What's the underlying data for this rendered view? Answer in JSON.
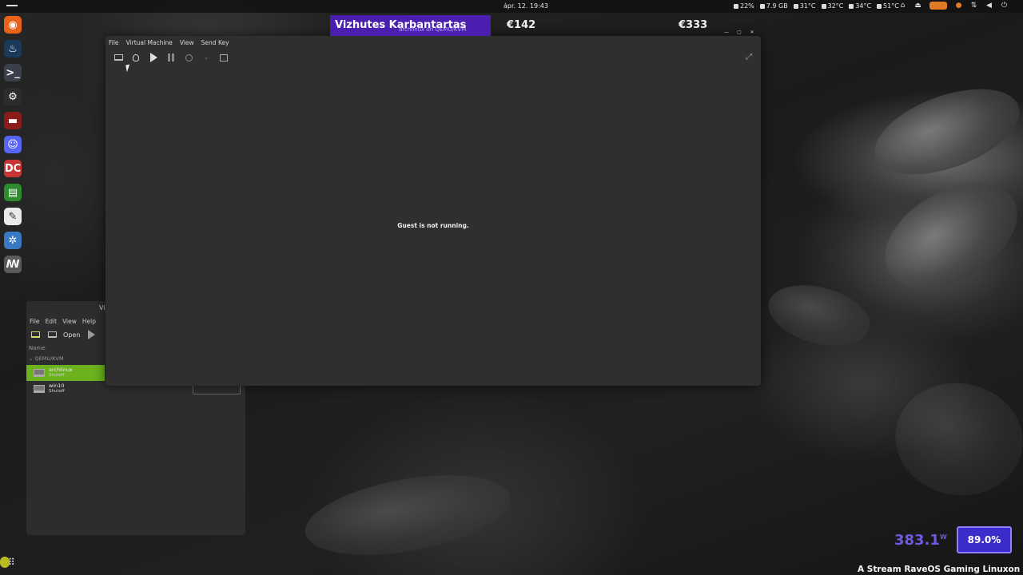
{
  "topbar": {
    "clock": "ápr. 12.  19:43",
    "stats": [
      "22%",
      "7.9 GB",
      "31°C",
      "32°C",
      "34°C",
      "51°C"
    ]
  },
  "dock": {
    "items": [
      {
        "name": "firefox",
        "color": "#e8621a",
        "glyph": "◉"
      },
      {
        "name": "steam",
        "color": "#1b3a5a",
        "glyph": "♨"
      },
      {
        "name": "terminal",
        "color": "#3a3f4b",
        "glyph": ">_"
      },
      {
        "name": "settings",
        "color": "#2d2d2d",
        "glyph": "⚙"
      },
      {
        "name": "lutris",
        "color": "#8a1c1c",
        "glyph": "▬"
      },
      {
        "name": "discord",
        "color": "#5865f2",
        "glyph": "☺"
      },
      {
        "name": "davinci",
        "color": "#c83434",
        "glyph": "DC"
      },
      {
        "name": "system-monitor",
        "color": "#2d8a2d",
        "glyph": "▤"
      },
      {
        "name": "text-editor",
        "color": "#e9e9e9",
        "glyph": "✎"
      },
      {
        "name": "virt-manager",
        "color": "#3b78c4",
        "glyph": "✲"
      },
      {
        "name": "ardour",
        "color": "#5a5a5a",
        "glyph": "ꟿ"
      }
    ]
  },
  "manager": {
    "title": "Vi",
    "menu": [
      "File",
      "Edit",
      "View",
      "Help"
    ],
    "open_label": "Open",
    "column_name": "Name",
    "group": "QEMU/KVM",
    "vms": [
      {
        "name": "archlinux",
        "state": "Shutoff"
      },
      {
        "name": "win10",
        "state": "Shutoff"
      }
    ]
  },
  "vmwin": {
    "menu": [
      "File",
      "Virtual Machine",
      "View",
      "Send Key"
    ],
    "message": "Guest is not running."
  },
  "overlay": {
    "banner_title": "Vizhutes Karbantartas",
    "banner_sub": "archlinux on QEMU/KVM",
    "price1": "€142",
    "price2": "€333",
    "watts": "383.1",
    "watts_unit": "W",
    "percent": "89.0%",
    "ticker": "A Stream RaveOS Gaming Linuxon fut"
  }
}
